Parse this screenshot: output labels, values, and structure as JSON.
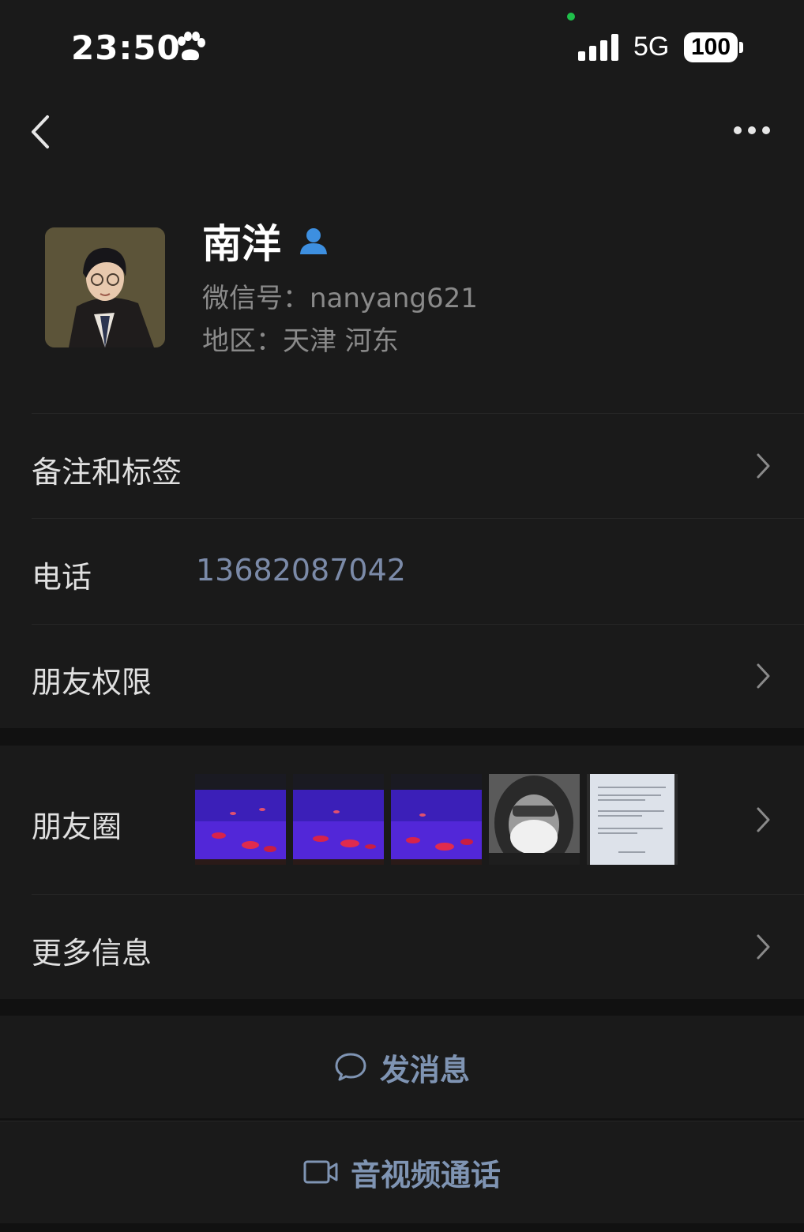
{
  "status_bar": {
    "time": "23:50",
    "network": "5G",
    "battery": "100"
  },
  "profile": {
    "name": "南洋",
    "wechat_id": "微信号：nanyang621",
    "region": "地区：天津 河东"
  },
  "rows": {
    "remarks_tags": "备注和标签",
    "phone_label": "电话",
    "phone_value": "13682087042",
    "friend_permissions": "朋友权限",
    "moments": "朋友圈",
    "more_info": "更多信息"
  },
  "actions": {
    "send_message": "发消息",
    "av_call": "音视频通话"
  },
  "colors": {
    "background": "#111111",
    "surface": "#1a1a1a",
    "accent_link": "#7f94b3",
    "person_icon": "#3d8fe0"
  },
  "icons": {
    "back": "chevron-left-icon",
    "more": "ellipsis-icon",
    "verified": "person-icon",
    "row_arrow": "chevron-right-icon",
    "message": "chat-bubble-icon",
    "call": "video-camera-icon"
  }
}
